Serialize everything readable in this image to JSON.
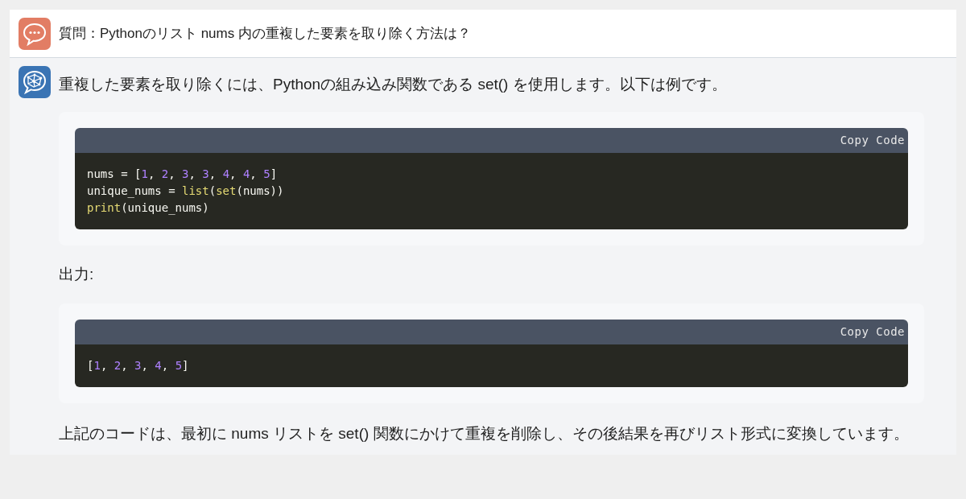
{
  "question": {
    "text": "質問：Pythonのリスト nums 内の重複した要素を取り除く方法は？"
  },
  "answer": {
    "blocks": [
      {
        "kind": "paragraph",
        "text": "重複した要素を取り除くには、Pythonの組み込み関数である set() を使用します。以下は例です。"
      },
      {
        "kind": "code",
        "copy_label": "Copy Code",
        "lines": [
          [
            {
              "kind": "plain",
              "text": "nums = ["
            },
            {
              "kind": "number",
              "text": "1"
            },
            {
              "kind": "plain",
              "text": ", "
            },
            {
              "kind": "number",
              "text": "2"
            },
            {
              "kind": "plain",
              "text": ", "
            },
            {
              "kind": "number",
              "text": "3"
            },
            {
              "kind": "plain",
              "text": ", "
            },
            {
              "kind": "number",
              "text": "3"
            },
            {
              "kind": "plain",
              "text": ", "
            },
            {
              "kind": "number",
              "text": "4"
            },
            {
              "kind": "plain",
              "text": ", "
            },
            {
              "kind": "number",
              "text": "4"
            },
            {
              "kind": "plain",
              "text": ", "
            },
            {
              "kind": "number",
              "text": "5"
            },
            {
              "kind": "plain",
              "text": "]"
            }
          ],
          [
            {
              "kind": "plain",
              "text": "unique_nums = "
            },
            {
              "kind": "builtin",
              "text": "list"
            },
            {
              "kind": "plain",
              "text": "("
            },
            {
              "kind": "builtin",
              "text": "set"
            },
            {
              "kind": "plain",
              "text": "(nums))"
            }
          ],
          [
            {
              "kind": "builtin",
              "text": "print"
            },
            {
              "kind": "plain",
              "text": "(unique_nums)"
            }
          ]
        ]
      },
      {
        "kind": "paragraph",
        "text": "出力:"
      },
      {
        "kind": "code",
        "copy_label": "Copy Code",
        "lines": [
          [
            {
              "kind": "plain",
              "text": "["
            },
            {
              "kind": "number",
              "text": "1"
            },
            {
              "kind": "plain",
              "text": ", "
            },
            {
              "kind": "number",
              "text": "2"
            },
            {
              "kind": "plain",
              "text": ", "
            },
            {
              "kind": "number",
              "text": "3"
            },
            {
              "kind": "plain",
              "text": ", "
            },
            {
              "kind": "number",
              "text": "4"
            },
            {
              "kind": "plain",
              "text": ", "
            },
            {
              "kind": "number",
              "text": "5"
            },
            {
              "kind": "plain",
              "text": "]"
            }
          ]
        ]
      },
      {
        "kind": "paragraph",
        "text": "上記のコードは、最初に nums リストを set() 関数にかけて重複を削除し、その後結果を再びリスト形式に変換しています。"
      }
    ]
  }
}
